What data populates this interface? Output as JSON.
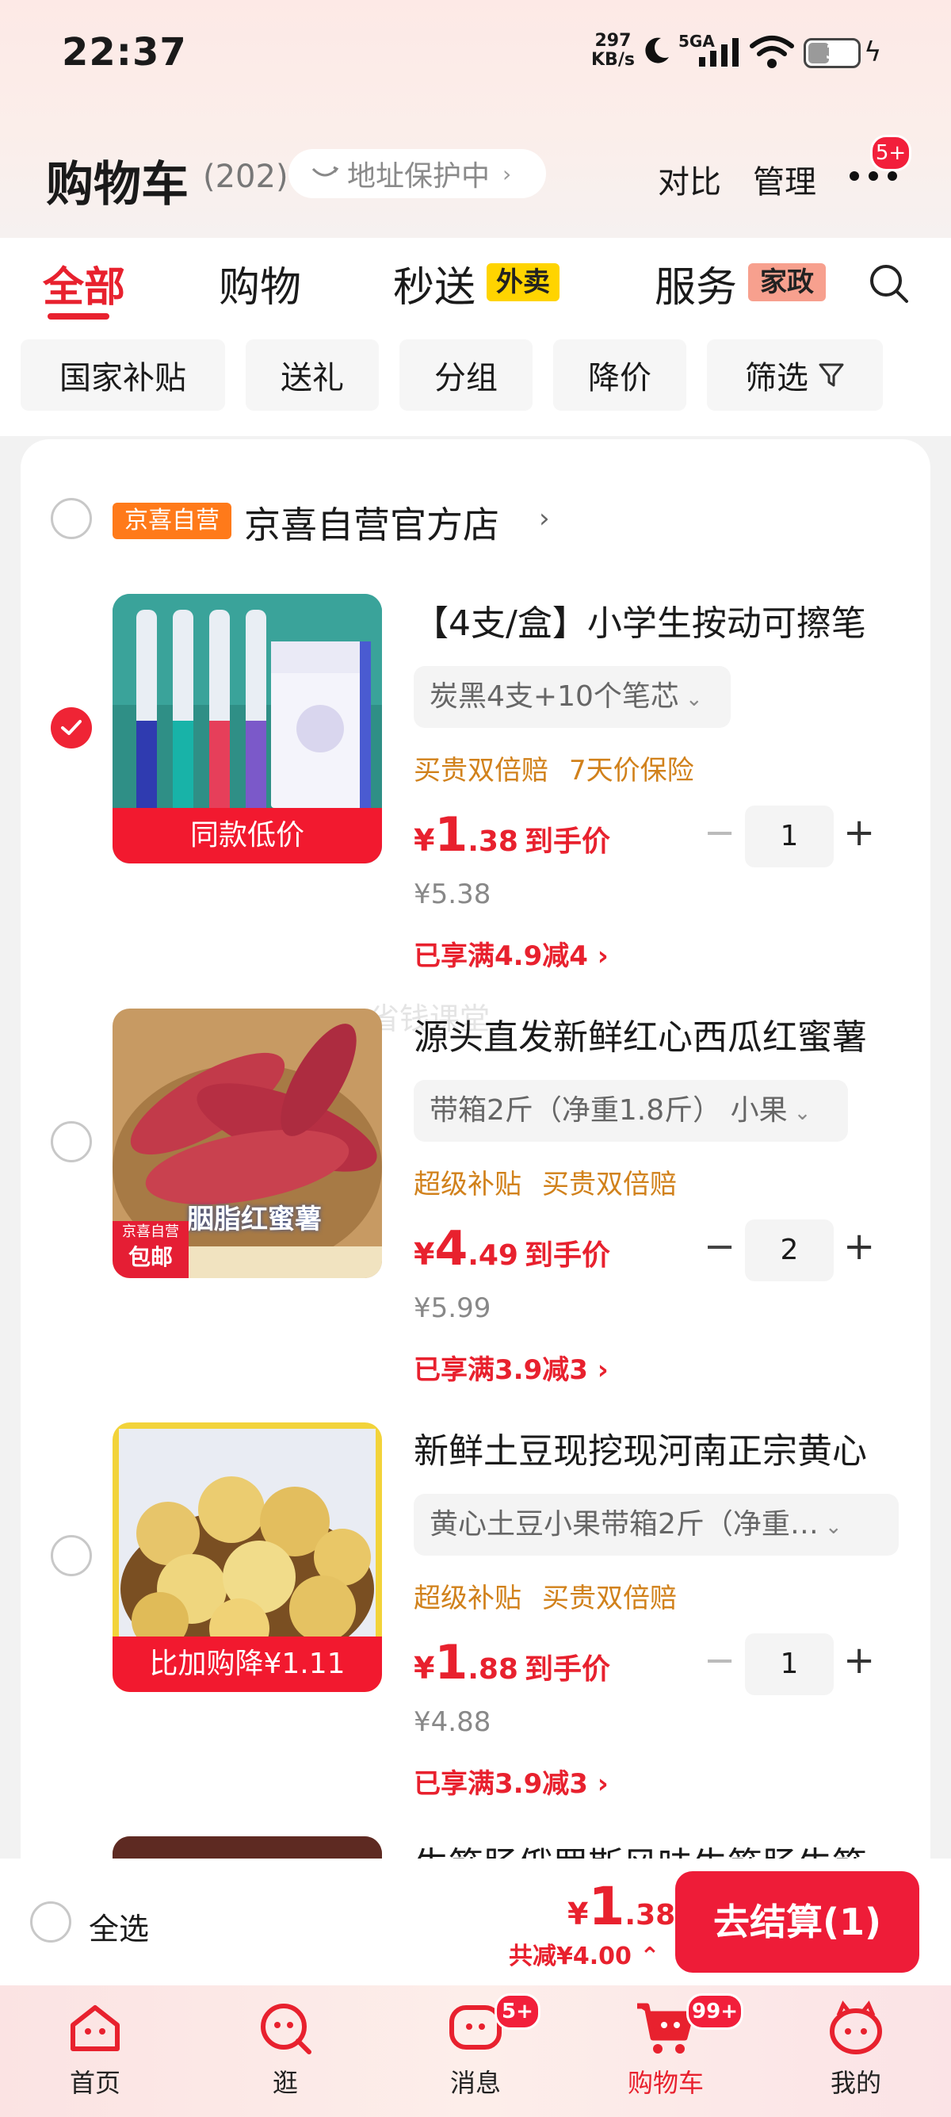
{
  "status_bar": {
    "time": "22:37",
    "net_speed_value": "297",
    "net_speed_unit": "KB/s",
    "network": "5GA",
    "battery": "3"
  },
  "header": {
    "title": "购物车",
    "count": "(202)",
    "address_protect": "地址保护中",
    "compare": "对比",
    "manage": "管理",
    "more_badge": "5+"
  },
  "tabs": {
    "all": "全部",
    "shopping": "购物",
    "second_delivery": "秒送",
    "waimai_tag": "外卖",
    "service": "服务",
    "jiazheng_tag": "家政"
  },
  "filters": [
    "国家补贴",
    "送礼",
    "分组",
    "降价",
    "筛选"
  ],
  "shop": {
    "tag": "京喜自营",
    "name": "京喜自营官方店",
    "arrow": "›"
  },
  "items": [
    {
      "title": "【4支/盒】小学生按动可擦笔",
      "variant": "炭黑4支+10个笔芯",
      "perks": [
        "买贵双倍赔",
        "7天价保险"
      ],
      "price_currency": "¥",
      "price_int": "1",
      "price_dec": ".38",
      "price_suffix": "到手价",
      "original_price": "¥5.38",
      "promo": "已享满4.9减4",
      "qty": "1",
      "thumb_label": "同款低价",
      "checked": true
    },
    {
      "title": "源头直发新鲜红心西瓜红蜜薯",
      "variant": "带箱2斤（净重1.8斤） 小果",
      "perks": [
        "超级补贴",
        "买贵双倍赔"
      ],
      "price_currency": "¥",
      "price_int": "4",
      "price_dec": ".49",
      "price_suffix": "到手价",
      "original_price": "¥5.99",
      "promo": "已享满3.9减3",
      "qty": "2",
      "thumb_label": "胭脂红蜜薯",
      "thumb_tag_top": "京喜自营",
      "thumb_tag_bottom": "包邮",
      "checked": false
    },
    {
      "title": "新鲜土豆现挖现河南正宗黄心",
      "variant": "黄心土豆小果带箱2斤（净重…",
      "perks": [
        "超级补贴",
        "买贵双倍赔"
      ],
      "price_currency": "¥",
      "price_int": "1",
      "price_dec": ".88",
      "price_suffix": "到手价",
      "original_price": "¥4.88",
      "promo": "已享满3.9减3",
      "qty": "1",
      "thumb_label": "比加购降¥1.11",
      "checked": false
    },
    {
      "title": "生筋肠俄罗斯风味牛筋肠牛筋"
    }
  ],
  "watermark": "省钱课堂",
  "checkout": {
    "select_all": "全选",
    "total_currency": "¥",
    "total_int": "1",
    "total_dec": ".38",
    "saved": "共减¥4.00",
    "pay_button": "去结算(1)"
  },
  "nav": {
    "home": "首页",
    "browse": "逛",
    "messages": "消息",
    "messages_badge": "5+",
    "cart": "购物车",
    "cart_badge": "99+",
    "me": "我的"
  },
  "colors": {
    "accent": "#e8212e",
    "shop_tag": "#ff7a1a",
    "perk_text": "#d1811b",
    "waimai_tag": "#ffd400",
    "jiazheng_tag": "#f7a08e"
  }
}
